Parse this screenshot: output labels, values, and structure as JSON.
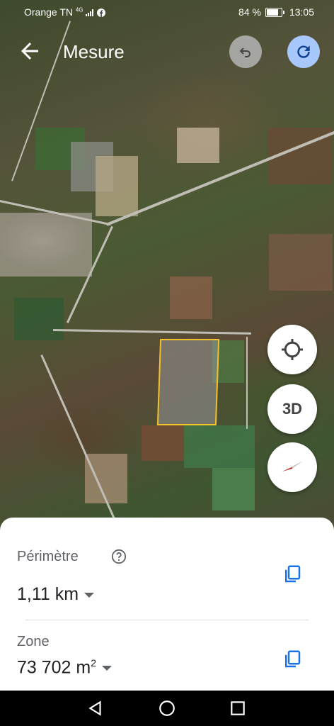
{
  "status_bar": {
    "carrier": "Orange TN",
    "network": "4G",
    "battery": "84 %",
    "time": "13:05"
  },
  "header": {
    "title": "Mesure"
  },
  "map_controls": {
    "view_3d_label": "3D"
  },
  "measurement": {
    "perimeter_label": "Périmètre",
    "perimeter_value": "1,11 km",
    "area_label": "Zone",
    "area_value": "73 702 m",
    "area_unit_exponent": "2"
  },
  "colors": {
    "accent": "#1a73e8",
    "selection_outline": "#f2c12a",
    "redo_button": "#a8c7fa"
  },
  "icons": {
    "back": "arrow-left-icon",
    "undo": "undo-icon",
    "redo": "redo-icon",
    "locate": "my-location-icon",
    "compass": "compass-icon",
    "help": "help-circle-icon",
    "copy": "copy-icon"
  }
}
